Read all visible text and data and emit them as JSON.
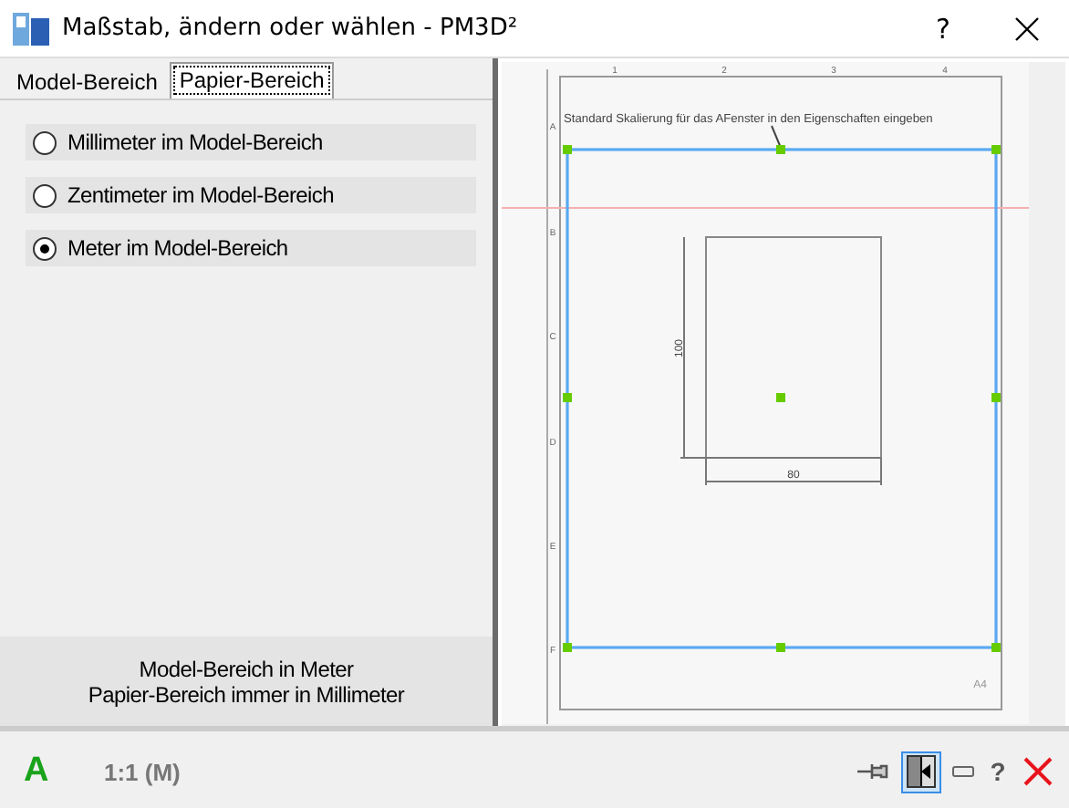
{
  "window": {
    "title": "Maßstab, ändern oder wählen - PM3D²",
    "help": "?"
  },
  "tabs": [
    {
      "label": "Model-Bereich",
      "selected": false
    },
    {
      "label": "Papier-Bereich",
      "selected": true
    }
  ],
  "options": [
    {
      "label": "Millimeter im Model-Bereich",
      "selected": false
    },
    {
      "label": "Zentimeter im Model-Bereich",
      "selected": false
    },
    {
      "label": "Meter im Model-Bereich",
      "selected": true
    }
  ],
  "info": [
    "Model-Bereich in Meter",
    "Papier-Bereich immer in Millimeter"
  ],
  "preview": {
    "ruler_columns": [
      "1",
      "2",
      "3",
      "4"
    ],
    "ruler_rows": [
      "A",
      "B",
      "C",
      "D",
      "E",
      "F"
    ],
    "annotation": "Standard Skalierung für das AFenster in den Eigenschaften eingeben",
    "height_dimension": "100",
    "width_dimension": "80",
    "paper_size": "A4"
  },
  "status_bar": {
    "mode": "A",
    "scale": "1:1 (M)",
    "help": "?",
    "panel_toggle": {
      "on": true
    }
  }
}
